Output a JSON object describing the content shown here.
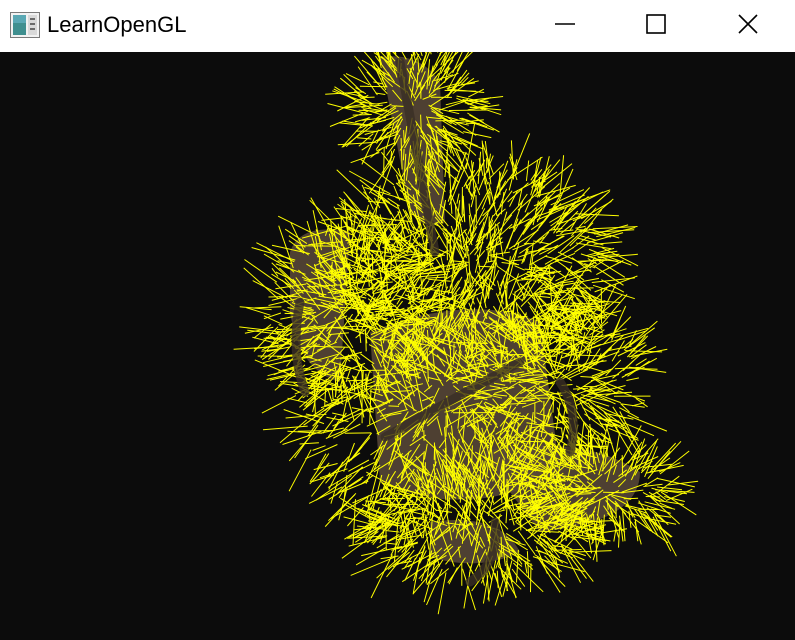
{
  "window": {
    "title": "LearnOpenGL",
    "controls": {
      "minimize_icon": "minimize-icon",
      "maximize_icon": "maximize-icon",
      "close_icon": "close-icon"
    }
  },
  "viewport": {
    "background_color": "#0c0c0c",
    "normal_line_color": "#ffff00",
    "model_color": "#5a4a3a"
  }
}
